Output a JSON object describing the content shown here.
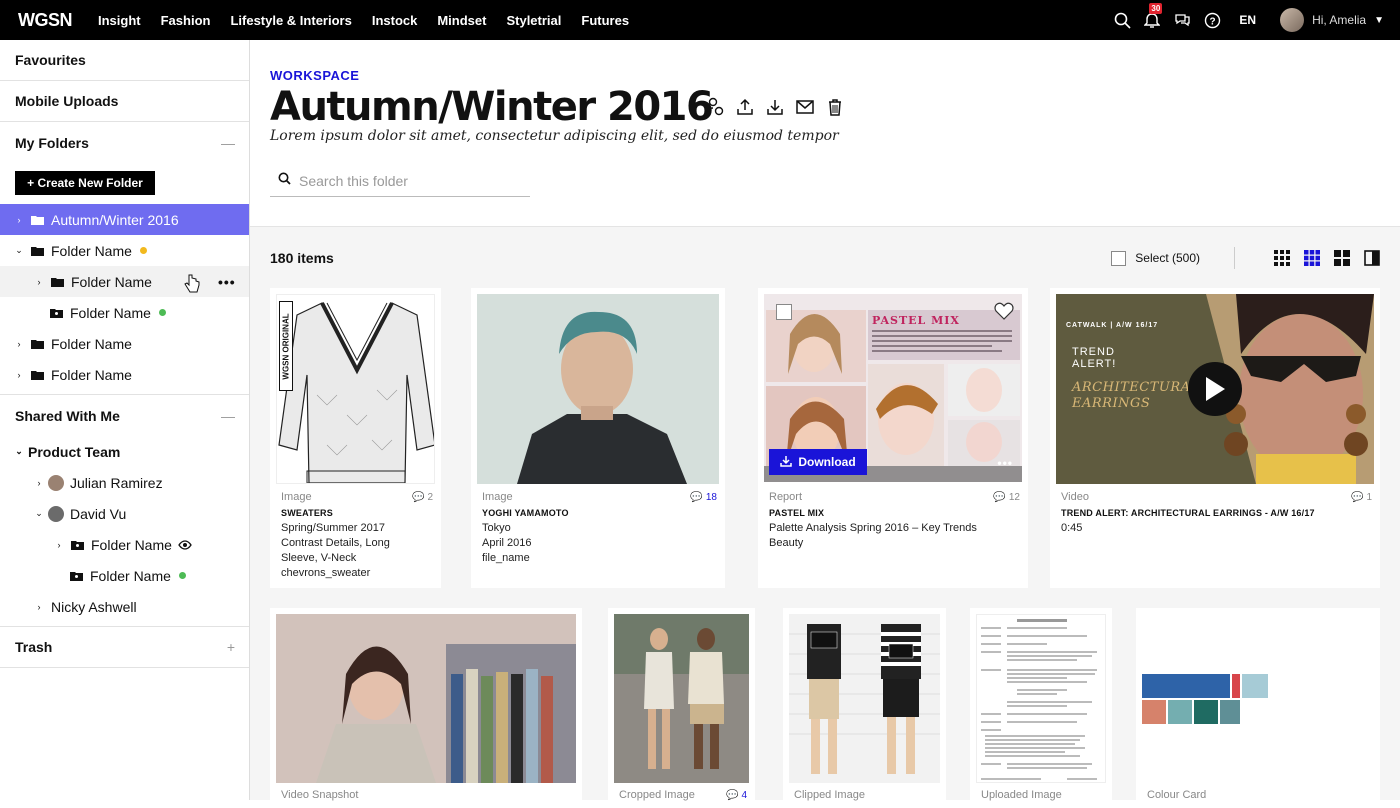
{
  "brand": {
    "logo": "WGSN"
  },
  "nav": [
    "Insight",
    "Fashion",
    "Lifestyle & Interiors",
    "Instock",
    "Mindset",
    "Styletrial",
    "Futures"
  ],
  "topright": {
    "badge": "30",
    "lang": "EN",
    "greeting": "Hi, Amelia"
  },
  "sidebar": {
    "favourites": "Favourites",
    "mobile_uploads": "Mobile Uploads",
    "my_folders": "My Folders",
    "create_folder": "+ Create New Folder",
    "folders": [
      {
        "label": "Autumn/Winter 2016"
      },
      {
        "label": "Folder Name",
        "dot": "#f2b91e"
      },
      {
        "label": "Folder Name"
      },
      {
        "label": "Folder Name",
        "dot": "#4dbb55"
      },
      {
        "label": "Folder Name"
      },
      {
        "label": "Folder Name"
      }
    ],
    "shared_with_me": "Shared With Me",
    "shared": [
      {
        "label": "Product Team"
      },
      {
        "label": "Julian Ramirez"
      },
      {
        "label": "David Vu"
      },
      {
        "label": "Folder Name"
      },
      {
        "label": "Folder Name"
      },
      {
        "label": "Nicky Ashwell"
      }
    ],
    "trash": "Trash"
  },
  "header": {
    "workspace": "WORKSPACE",
    "title": "Autumn/Winter 2016",
    "description": "Lorem ipsum dolor sit amet, consectetur adipiscing elit, sed do eiusmod tempor",
    "search_placeholder": "Search this folder"
  },
  "toolbar": {
    "count": "180 items",
    "select_label": "Select (500)"
  },
  "cards": [
    {
      "type": "Image",
      "title": "SWEATERS",
      "lines": [
        "Spring/Summer 2017",
        "Contrast Details, Long",
        "Sleeve, V-Neck",
        "chevrons_sweater"
      ],
      "comments": "2",
      "overlay": "WGSN ORIGINAL"
    },
    {
      "type": "Image",
      "title": "YOGHI YAMAMOTO",
      "lines": [
        "Tokyo",
        "April 2016",
        "file_name"
      ],
      "comments": "18"
    },
    {
      "type": "Report",
      "title": "PASTEL MIX",
      "lines": [
        "Palette Analysis Spring 2016 – Key Trends",
        "Beauty"
      ],
      "comments": "12",
      "download": "Download",
      "overlay": "PASTEL MIX"
    },
    {
      "type": "Video",
      "title": "TREND ALERT: ARCHITECTURAL EARRINGS - A/W 16/17",
      "lines": [
        "0:45"
      ],
      "comments": "1",
      "overlay_tag": "CATWALK | A/W 16/17",
      "overlay_title1": "TREND ALERT!",
      "overlay_title2": "ARCHITECTURAL EARRINGS"
    },
    {
      "type": "Video Snapshot"
    },
    {
      "type": "Cropped Image",
      "comments": "4"
    },
    {
      "type": "Clipped Image"
    },
    {
      "type": "Uploaded Image"
    },
    {
      "type": "Colour Card"
    }
  ],
  "colors": {
    "accent": "#1a14d8",
    "selected": "#6f6cf0"
  }
}
